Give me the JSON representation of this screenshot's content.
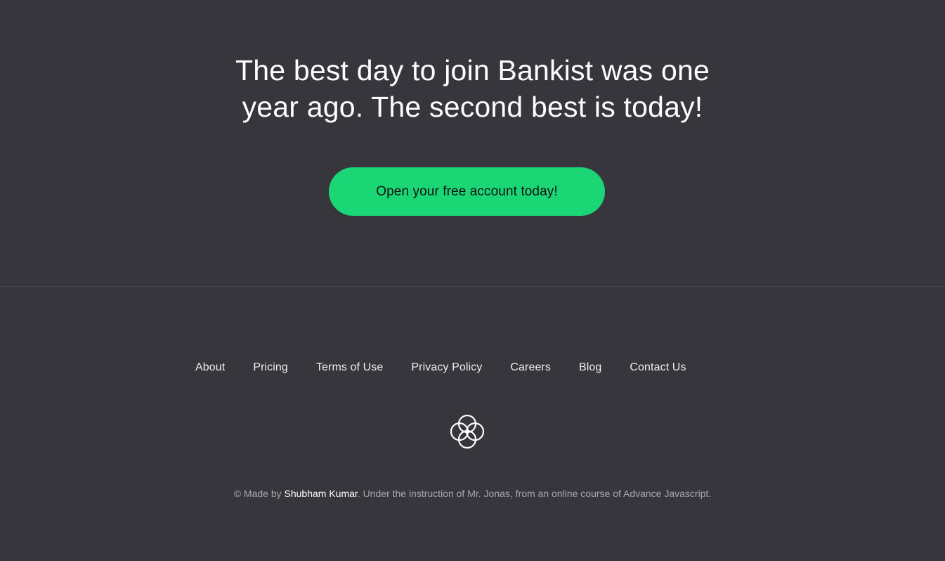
{
  "signup": {
    "title_line_1": "The best day to join Bankist was one",
    "title_line_2": "year ago. The second best is today!",
    "cta_label": "Open your free account today!"
  },
  "colors": {
    "background": "#37363d",
    "accent_green": "#1bd675",
    "text_white": "#ffffff",
    "muted_text": "#a8a8ac"
  },
  "footer": {
    "nav": [
      {
        "label": "About"
      },
      {
        "label": "Pricing"
      },
      {
        "label": "Terms of Use"
      },
      {
        "label": "Privacy Policy"
      },
      {
        "label": "Careers"
      },
      {
        "label": "Blog"
      },
      {
        "label": "Contact Us"
      }
    ],
    "logo_icon": "four-circles-logo-icon",
    "copyright": {
      "prefix": "© Made by ",
      "author": "Shubham Kumar",
      "suffix": ". Under the instruction of Mr. Jonas, from an online course of Advance Javascript."
    }
  }
}
